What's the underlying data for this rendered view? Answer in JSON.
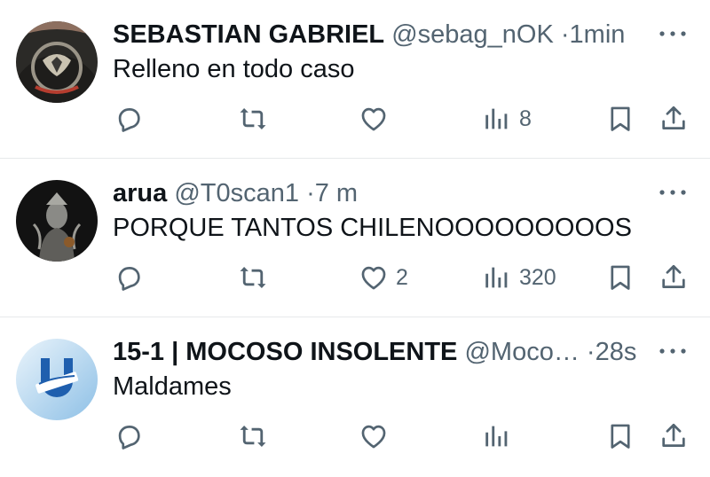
{
  "tweets": [
    {
      "name": "SEBASTIAN GABRIEL",
      "handle": "@sebag_nOK",
      "sep": "·",
      "time": "1min",
      "text": "Relleno en todo caso",
      "replies": "",
      "retweets": "",
      "likes": "",
      "views": "8",
      "avatar_icon": "cobra-kai-shirt-avatar"
    },
    {
      "name": "arua",
      "handle": "@T0scan1",
      "sep": "·",
      "time": "7 m",
      "text": "PORQUE TANTOS CHILENOOOOOOOOOS",
      "replies": "",
      "retweets": "",
      "likes": "2",
      "views": "320",
      "avatar_icon": "dark-statue-avatar"
    },
    {
      "name": "15-1 | MOCOSO INSOLENTE",
      "handle": "@Moco…",
      "sep": "·",
      "time": "28s",
      "text": "Maldames",
      "replies": "",
      "retweets": "",
      "likes": "",
      "views": "",
      "avatar_icon": "universidad-catolica-u-logo-avatar"
    }
  ],
  "colors": {
    "text": "#0f1419",
    "secondary": "#536471",
    "divider": "#e7e9eb"
  }
}
